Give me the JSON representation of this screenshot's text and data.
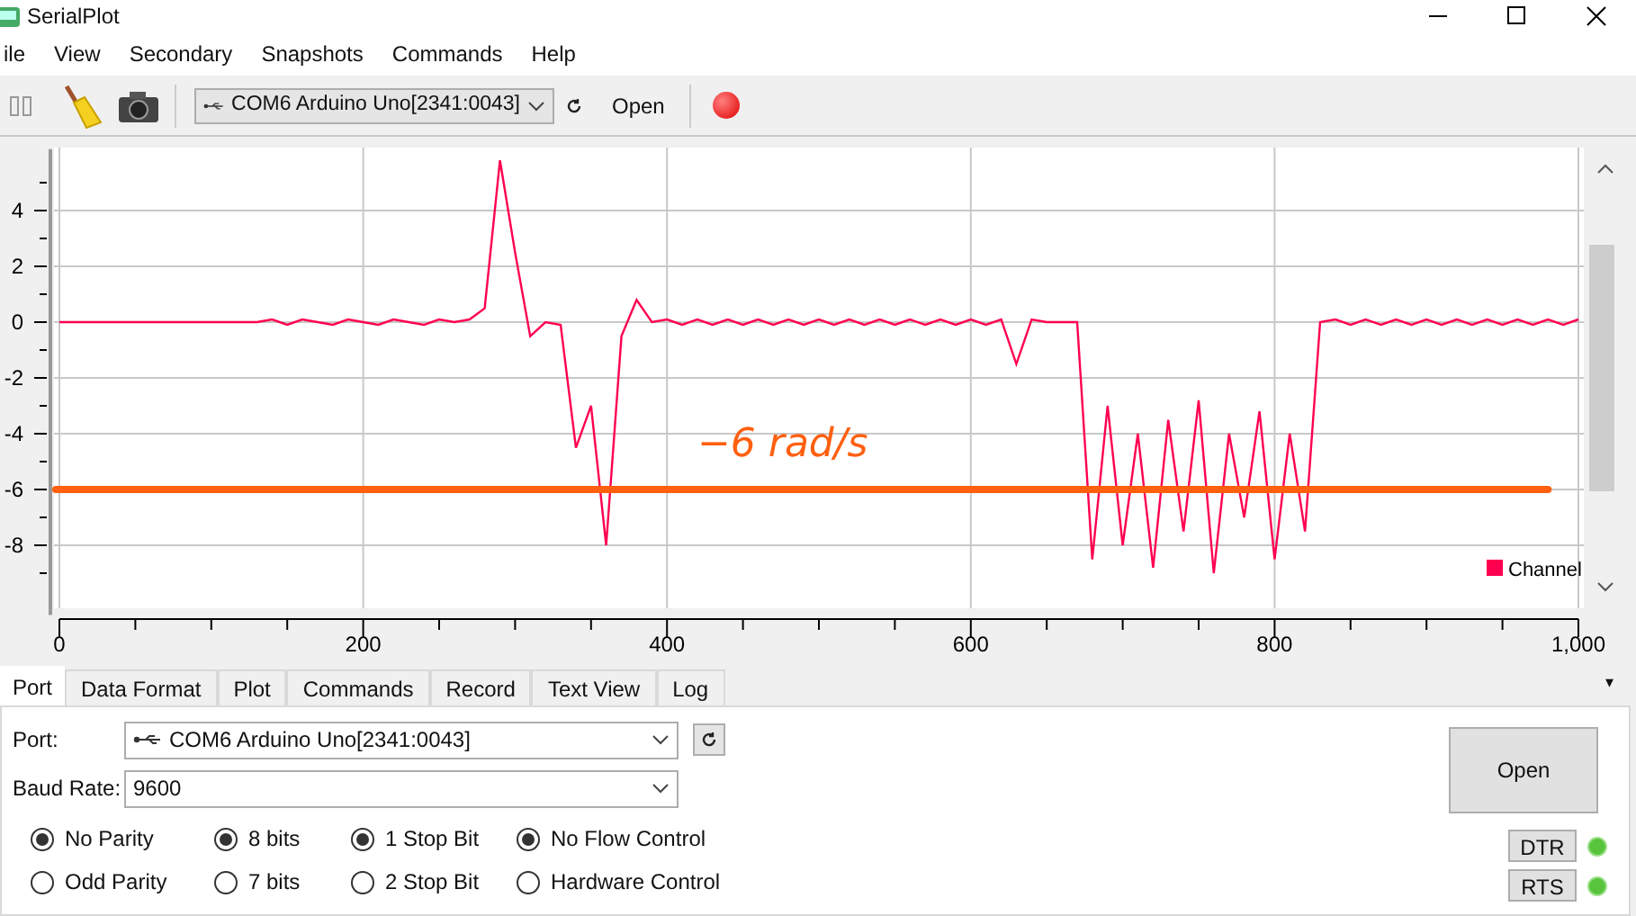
{
  "window": {
    "title": "SerialPlot"
  },
  "menu": [
    "ile",
    "View",
    "Secondary",
    "Snapshots",
    "Commands",
    "Help"
  ],
  "toolbar": {
    "port": "COM6 Arduino Uno[2341:0043]",
    "open_button": "Open"
  },
  "chart_data": {
    "type": "line",
    "x": [
      0,
      10,
      20,
      30,
      40,
      50,
      60,
      70,
      80,
      90,
      100,
      110,
      120,
      130,
      140,
      150,
      160,
      170,
      180,
      190,
      200,
      210,
      220,
      230,
      240,
      250,
      260,
      270,
      280,
      290,
      300,
      310,
      320,
      330,
      340,
      350,
      360,
      370,
      380,
      390,
      400,
      410,
      420,
      430,
      440,
      450,
      460,
      470,
      480,
      490,
      500,
      510,
      520,
      530,
      540,
      550,
      560,
      570,
      580,
      590,
      600,
      610,
      620,
      630,
      640,
      650,
      660,
      670,
      680,
      690,
      700,
      710,
      720,
      730,
      740,
      750,
      760,
      770,
      780,
      790,
      800,
      810,
      820,
      830,
      840,
      850,
      860,
      870,
      880,
      890,
      900,
      910,
      920,
      930,
      940,
      950,
      960,
      970,
      980,
      990,
      1000
    ],
    "series": [
      {
        "name": "Channel",
        "color": "#ff0050",
        "values": [
          0,
          0,
          0,
          0,
          0,
          0,
          0,
          0,
          0,
          0,
          0,
          0,
          0,
          0,
          0.1,
          -0.1,
          0.1,
          0,
          -0.1,
          0.1,
          0,
          -0.1,
          0.1,
          0,
          -0.1,
          0.1,
          0,
          0.1,
          0.5,
          5.8,
          2.5,
          -0.5,
          0,
          -0.1,
          -4.5,
          -3,
          -8,
          -0.5,
          0.8,
          0,
          0.1,
          -0.1,
          0.1,
          -0.1,
          0.1,
          -0.1,
          0.1,
          -0.1,
          0.1,
          -0.1,
          0.1,
          -0.1,
          0.1,
          -0.1,
          0.1,
          -0.1,
          0.1,
          -0.1,
          0.1,
          -0.1,
          0.1,
          -0.1,
          0.1,
          -1.5,
          0.1,
          0,
          0,
          0,
          -8.5,
          -3,
          -8,
          -4,
          -8.8,
          -3.5,
          -7.5,
          -2.8,
          -9,
          -4,
          -7,
          -3.2,
          -8.5,
          -4,
          -7.5,
          0,
          0.1,
          -0.1,
          0.1,
          -0.1,
          0.1,
          -0.1,
          0.1,
          -0.1,
          0.1,
          -0.1,
          0.1,
          -0.1,
          0.1,
          -0.1,
          0.1,
          -0.1,
          0.1
        ]
      }
    ],
    "xlim": [
      0,
      1000
    ],
    "ylim": [
      -10.5,
      6.2
    ],
    "grid": true,
    "xticks": [
      0,
      200,
      400,
      600,
      800,
      {
        "value": 1000,
        "label": "1,000"
      }
    ],
    "yticks": [
      -8,
      -6,
      -4,
      -2,
      0,
      2,
      4
    ],
    "ref_lines": [
      {
        "axis": "y",
        "value": -6,
        "color": "#ff6010"
      }
    ],
    "annotations": [
      "−6 rad/s"
    ]
  },
  "tabs": [
    {
      "label": "Port",
      "selected": true
    },
    {
      "label": "Data Format",
      "selected": false
    },
    {
      "label": "Plot",
      "selected": false
    },
    {
      "label": "Commands",
      "selected": false
    },
    {
      "label": "Record",
      "selected": false
    },
    {
      "label": "Text View",
      "selected": false
    },
    {
      "label": "Log",
      "selected": false
    }
  ],
  "tabs_menu": "▾",
  "port_panel": {
    "port_label": "Port:",
    "port_value": "COM6 Arduino Uno[2341:0043]",
    "baud_label": "Baud Rate:",
    "baud_value": "9600",
    "radio_groups": [
      [
        {
          "label": "No Parity",
          "selected": true
        },
        {
          "label": "Odd Parity",
          "selected": false
        }
      ],
      [
        {
          "label": "8 bits",
          "selected": true
        },
        {
          "label": "7 bits",
          "selected": false
        }
      ],
      [
        {
          "label": "1 Stop Bit",
          "selected": true
        },
        {
          "label": "2 Stop Bit",
          "selected": false
        }
      ],
      [
        {
          "label": "No Flow Control",
          "selected": true
        },
        {
          "label": "Hardware Control",
          "selected": false
        }
      ]
    ],
    "open_button": "Open",
    "signals": [
      {
        "label": "DTR",
        "on": true
      },
      {
        "label": "RTS",
        "on": true
      }
    ]
  }
}
